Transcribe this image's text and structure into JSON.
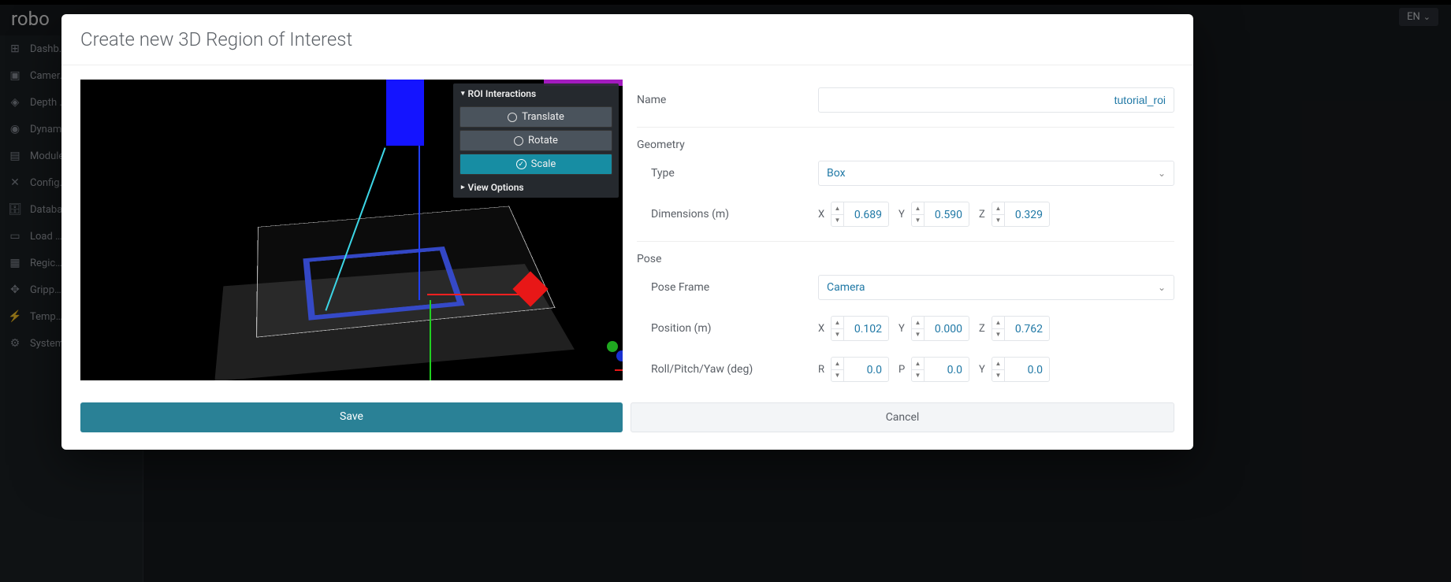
{
  "app": {
    "logo": "robo",
    "language": "EN"
  },
  "sidebar": {
    "items": [
      {
        "icon": "⊞",
        "label": "Dashb…"
      },
      {
        "icon": "▣",
        "label": "Camer…"
      },
      {
        "icon": "◈",
        "label": "Depth …"
      },
      {
        "icon": "◉",
        "label": "Dynam…"
      },
      {
        "icon": "▤",
        "label": "Module…"
      },
      {
        "icon": "✕",
        "label": "Config…"
      },
      {
        "icon": "🗄",
        "label": "Databa…"
      },
      {
        "icon": "▭",
        "label": "Load …"
      },
      {
        "icon": "▦",
        "label": "Regic…"
      },
      {
        "icon": "✥",
        "label": "Gripp…"
      },
      {
        "icon": "⚡",
        "label": "Temp…"
      },
      {
        "icon": "⚙",
        "label": "System…"
      }
    ]
  },
  "modal": {
    "title": "Create new 3D Region of Interest",
    "viewer_panel": {
      "roi_title": "ROI Interactions",
      "translate": "Translate",
      "rotate": "Rotate",
      "scale": "Scale",
      "view_options": "View Options"
    },
    "form": {
      "name_label": "Name",
      "name_value": "tutorial_roi",
      "geometry_label": "Geometry",
      "type_label": "Type",
      "type_value": "Box",
      "dimensions_label": "Dimensions (m)",
      "dimensions": {
        "x_label": "X",
        "x": "0.689",
        "y_label": "Y",
        "y": "0.590",
        "z_label": "Z",
        "z": "0.329"
      },
      "pose_label": "Pose",
      "pose_frame_label": "Pose Frame",
      "pose_frame_value": "Camera",
      "position_label": "Position (m)",
      "position": {
        "x_label": "X",
        "x": "0.102",
        "y_label": "Y",
        "y": "0.000",
        "z_label": "Z",
        "z": "0.762"
      },
      "rpy_label": "Roll/Pitch/Yaw (deg)",
      "rpy": {
        "r_label": "R",
        "r": "0.0",
        "p_label": "P",
        "p": "0.0",
        "y_label": "Y",
        "y": "0.0"
      }
    },
    "buttons": {
      "save": "Save",
      "cancel": "Cancel"
    }
  }
}
